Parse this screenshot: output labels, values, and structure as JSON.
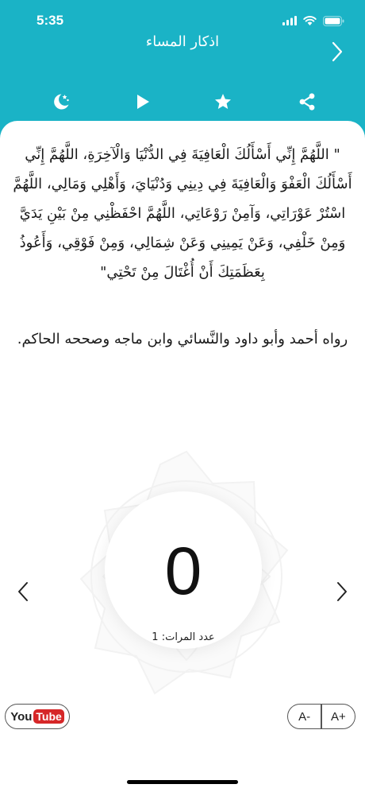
{
  "status_bar": {
    "time": "5:35"
  },
  "header": {
    "title": "اذكار المساء",
    "back_icon": "chevron-right-icon",
    "background_color": "#1ab3c6"
  },
  "toolbar": {
    "items": [
      "moon-stars-icon",
      "play-icon",
      "star-icon",
      "share-icon"
    ]
  },
  "dhikr": {
    "text": "\" اللَّهُمَّ إِنِّي أَسْأَلُكَ الْعَافِيَةَ فِي الدُّنْيَا وَالْآخِرَةِ، اللَّهُمَّ إِنِّي أَسْأَلُكَ الْعَفْوَ وَالْعَافِيَةَ فِي دِينِي وَدُنْيَايَ، وَأَهْلِي وَمَالِي، اللَّهُمَّ اسْتُرْ عَوْرَاتِي، وَآمِنْ رَوْعَاتِي، اللَّهُمَّ احْفَظْنِي مِنْ بَيْنِ يَدَيَّ وَمِنْ خَلْفِي، وَعَنْ يَمِينِي وَعَنْ شِمَالِي، وَمِنْ فَوْقِي، وَأَعُوذُ بِعَظَمَتِكَ أَنْ أُغْتَالَ مِنْ تَحْتِي\"",
    "source": "رواه أحمد وأبو داود والنَّسائي وابن ماجه وصححه الحاكم."
  },
  "counter": {
    "count": "0",
    "repeat_label": "عدد المرات: 1"
  },
  "navigation": {
    "previous_icon": "chevron-left-icon",
    "next_icon": "chevron-right-icon"
  },
  "footer": {
    "youtube_you": "You",
    "youtube_tube": "Tube",
    "font_decrease": "A-",
    "font_increase": "A+"
  }
}
